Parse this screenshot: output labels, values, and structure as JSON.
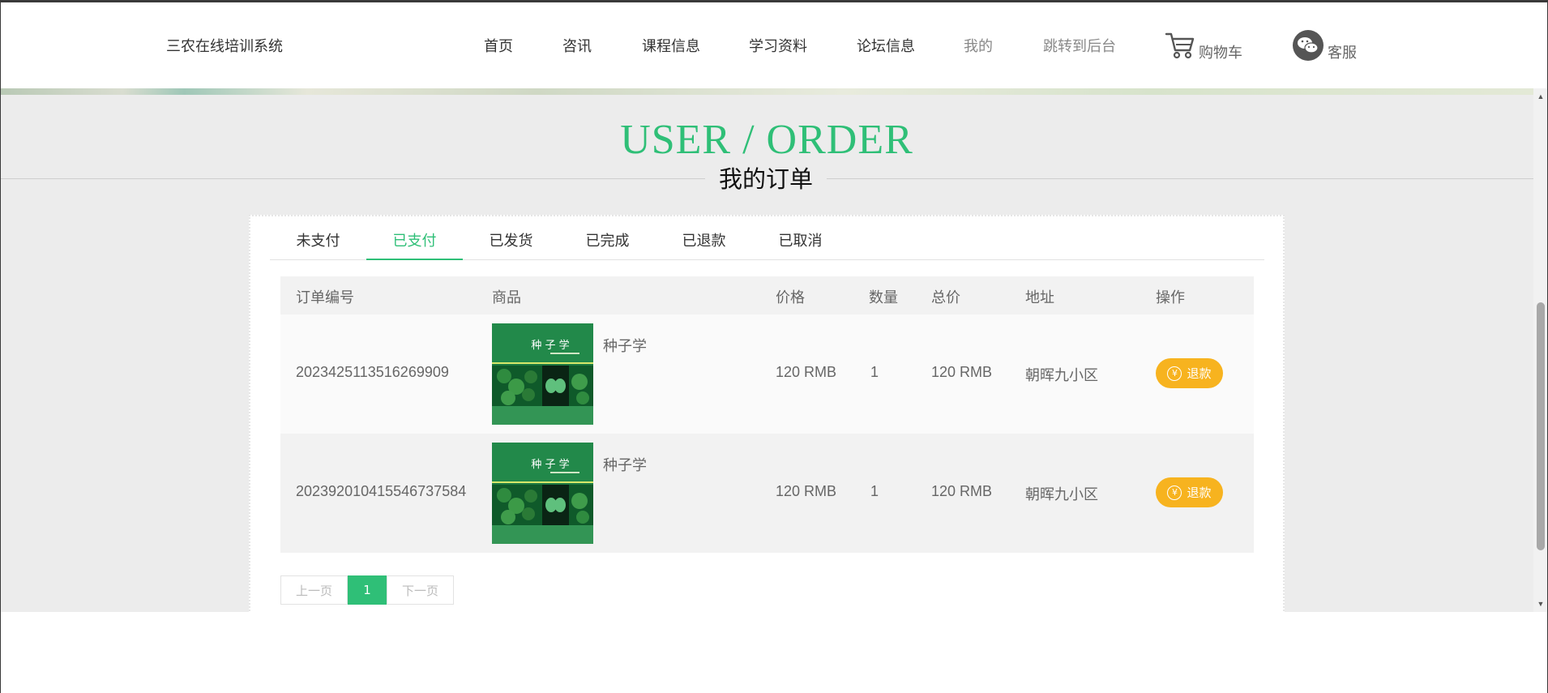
{
  "header": {
    "brand": "三农在线培训系统",
    "nav": [
      "首页",
      "咨讯",
      "课程信息",
      "学习资料",
      "论坛信息",
      "我的",
      "跳转到后台"
    ],
    "cart_label": "购物车",
    "service_label": "客服"
  },
  "page": {
    "title_en": "USER / ORDER",
    "title_cn": "我的订单"
  },
  "tabs": {
    "items": [
      "未支付",
      "已支付",
      "已发货",
      "已完成",
      "已退款",
      "已取消"
    ],
    "active": "已支付"
  },
  "table": {
    "headers": [
      "订单编号",
      "商品",
      "价格",
      "数量",
      "总价",
      "地址",
      "操作"
    ],
    "rows": [
      {
        "order_no": "2023425113516269909",
        "product_name": "种子学",
        "product_cover_text": "种 子 学",
        "price": "120 RMB",
        "qty": "1",
        "total": "120 RMB",
        "address": "朝晖九小区",
        "action": "退款"
      },
      {
        "order_no": "20239201041554673758 4",
        "product_name": "种子学",
        "product_cover_text": "种 子 学",
        "price": "120 RMB",
        "qty": "1",
        "total": "120 RMB",
        "address": "朝晖九小区",
        "action": "退款"
      }
    ]
  },
  "pager": {
    "prev": "上一页",
    "current": "1",
    "next": "下一页"
  },
  "colors": {
    "accent": "#2fbf77",
    "refund": "#f7b31f",
    "icon": "#555555"
  }
}
